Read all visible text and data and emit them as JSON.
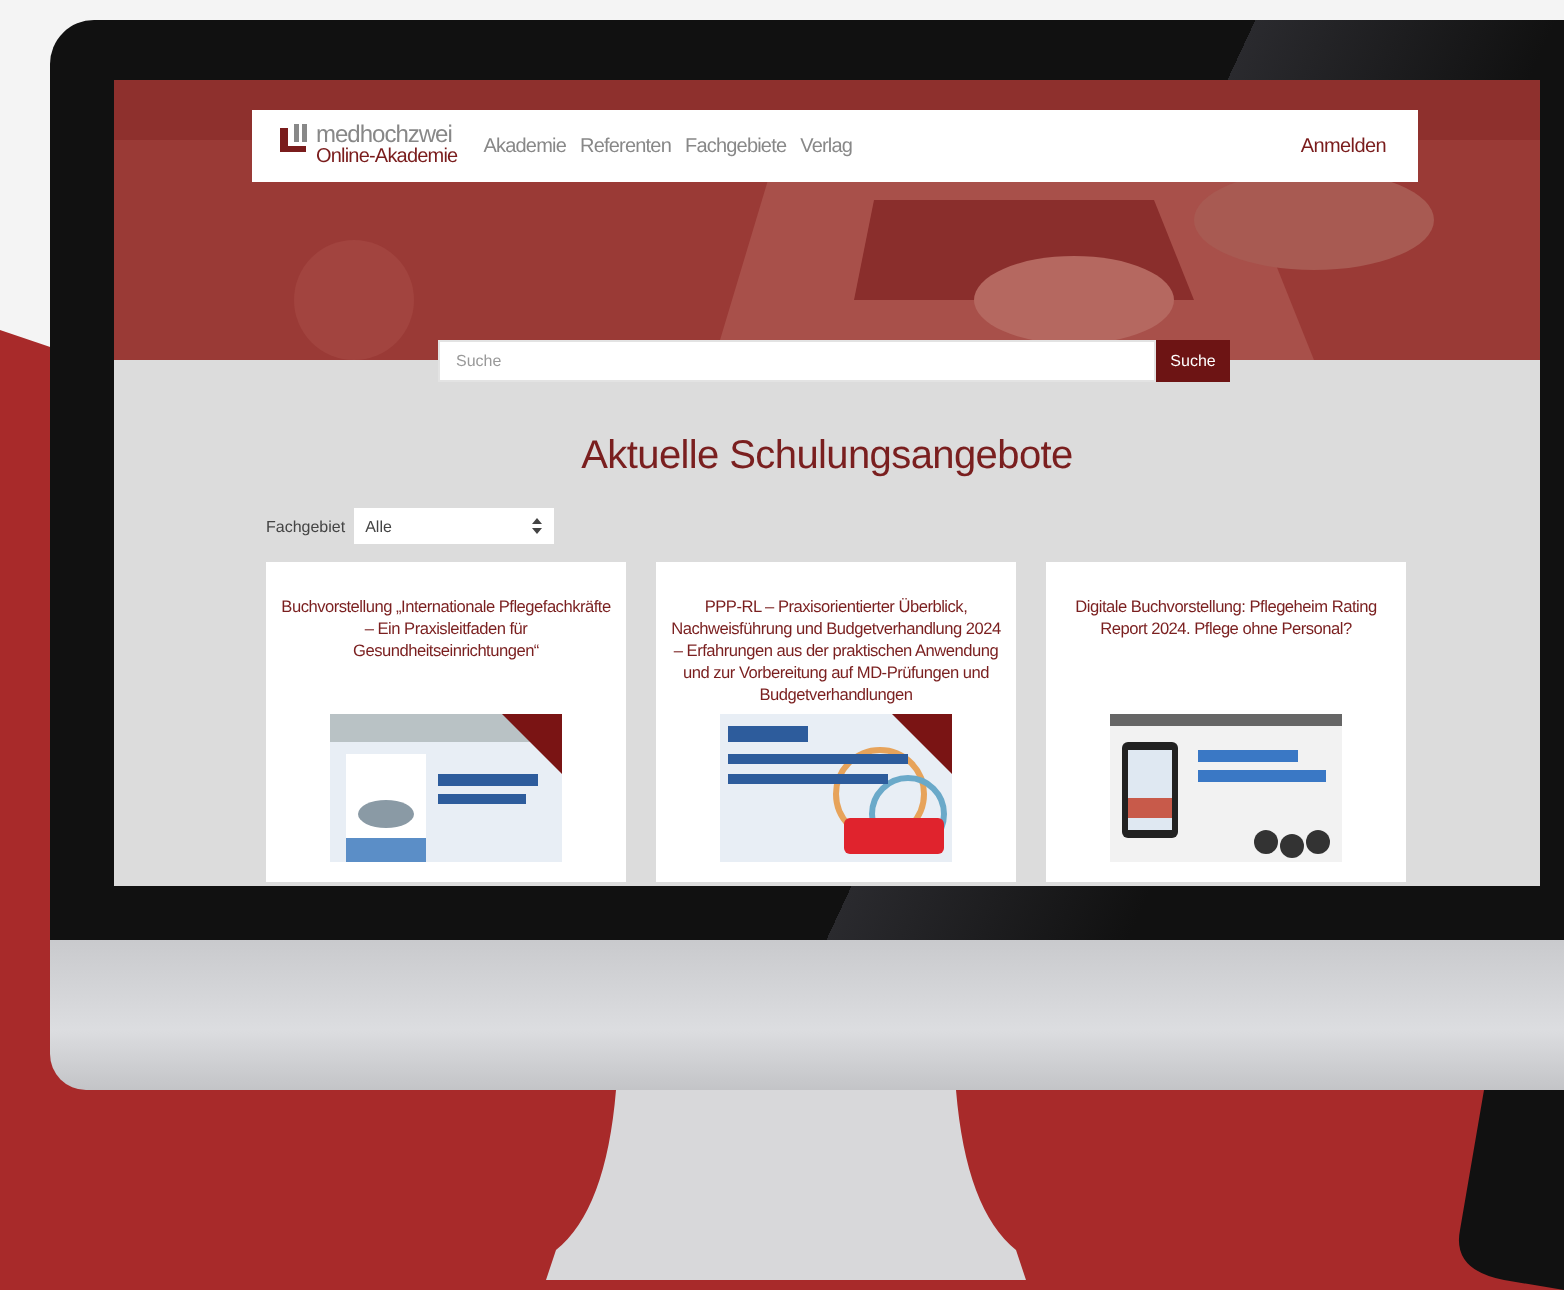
{
  "nav": {
    "logo_top": "medhochzwei",
    "logo_bottom": "Online-Akademie",
    "links": [
      "Akademie",
      "Referenten",
      "Fachgebiete",
      "Verlag"
    ],
    "login": "Anmelden"
  },
  "search": {
    "placeholder": "Suche",
    "button": "Suche"
  },
  "heading": "Aktuelle Schulungsangebote",
  "filter": {
    "label": "Fachgebiet",
    "value": "Alle"
  },
  "cards": [
    {
      "title": "Buchvorstellung „Internationale Pflegefachkräfte – Ein Praxisleitfaden für Gesundheitseinrichtungen“"
    },
    {
      "title": "PPP-RL – Praxisorientierter Überblick, Nachweisführung und Budgetverhandlung 2024 – Erfahrungen aus der praktischen Anwendung und zur Vorbereitung auf MD-Prüfungen und Budgetverhandlungen"
    },
    {
      "title": "Digitale Buchvorstellung: Pflegeheim Rating Report 2024. Pflege ohne Personal?"
    }
  ]
}
